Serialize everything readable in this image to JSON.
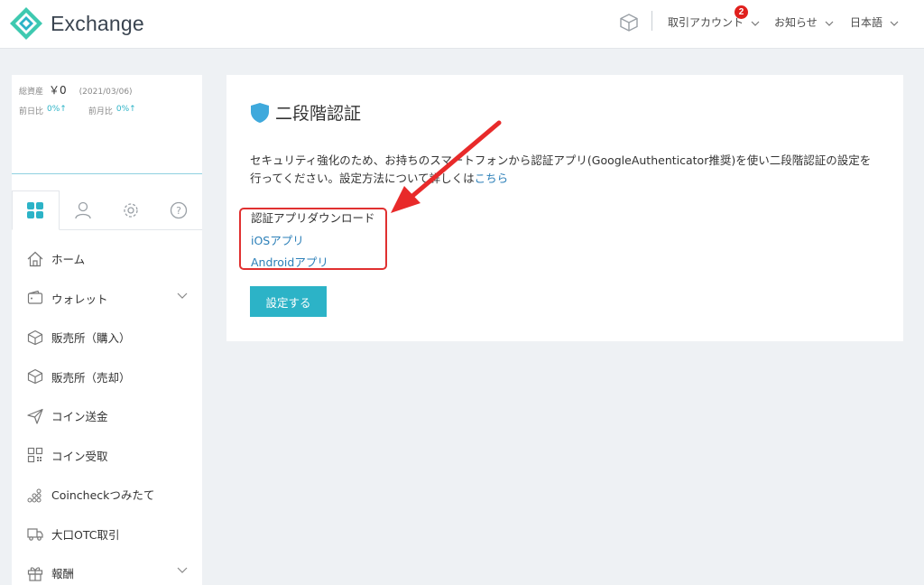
{
  "header": {
    "brand": "Exchange",
    "account_label": "取引アカウント",
    "account_badge": "2",
    "news_label": "お知らせ",
    "language_label": "日本語"
  },
  "sidebar": {
    "assets": {
      "total_label": "総資産",
      "total_value": "￥0",
      "date": "(2021/03/06)",
      "day_label": "前日比",
      "day_value": "0%↑",
      "month_label": "前月比",
      "month_value": "0%↑"
    },
    "tabs": [
      "grid",
      "user",
      "settings",
      "help"
    ],
    "menu": [
      {
        "label": "ホーム",
        "icon": "home-icon"
      },
      {
        "label": "ウォレット",
        "icon": "wallet-icon",
        "expandable": true
      },
      {
        "label": "販売所（購入）",
        "icon": "cube-icon"
      },
      {
        "label": "販売所（売却）",
        "icon": "cube-icon"
      },
      {
        "label": "コイン送金",
        "icon": "send-icon"
      },
      {
        "label": "コイン受取",
        "icon": "qr-icon"
      },
      {
        "label": "Coincheckつみたて",
        "icon": "coins-icon"
      },
      {
        "label": "大口OTC取引",
        "icon": "truck-icon"
      },
      {
        "label": "報酬",
        "icon": "gift-icon",
        "expandable": true
      }
    ]
  },
  "main": {
    "title": "二段階認証",
    "description": "セキュリティ強化のため、お持ちのスマートフォンから認証アプリ(GoogleAuthenticator推奨)を使い二段階認証の設定を行ってください。設定方法について詳しくは",
    "description_link": "こちら",
    "download_title": "認証アプリダウンロード",
    "ios_link": "iOSアプリ",
    "android_link": "Androidアプリ",
    "setup_button": "設定する"
  },
  "colors": {
    "accent": "#2cb3c7",
    "link": "#2b7fb8",
    "highlight": "#e03030",
    "badge": "#e0201d"
  }
}
